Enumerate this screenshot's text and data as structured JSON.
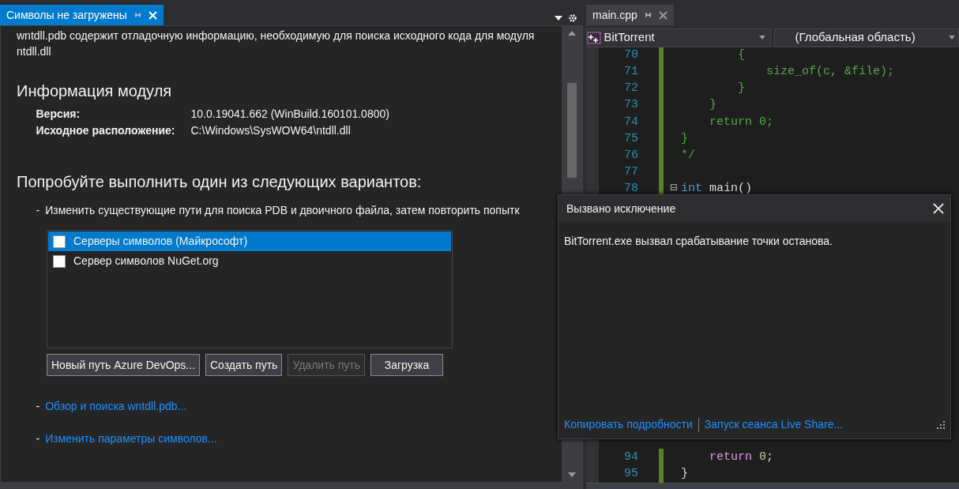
{
  "left_pane": {
    "tab": {
      "title": "Символы не загружены",
      "selected": true
    },
    "description": "wntdll.pdb содержит отладочную информацию, необходимую для поиска исходного кода для модуля ntdll.dll",
    "module_info": {
      "heading": "Информация модуля",
      "fields": [
        {
          "label": "Версия:",
          "value": "10.0.19041.662 (WinBuild.160101.0800)"
        },
        {
          "label": "Исходное расположение:",
          "value": "C:\\Windows\\SysWOW64\\ntdll.dll"
        }
      ]
    },
    "options_heading": "Попробуйте выполнить один из следующих вариантов:",
    "option_dash": "-",
    "option_text": "Изменить существующие пути для поиска PDB и двоичного файла, затем повторить попытк",
    "symbol_servers": [
      {
        "label": "Серверы символов (Майкрософт)",
        "checked": false,
        "selected": true
      },
      {
        "label": "Сервер символов NuGet.org",
        "checked": false,
        "selected": false
      }
    ],
    "buttons": [
      {
        "label": "Новый путь Azure DevOps...",
        "disabled": false
      },
      {
        "label": "Создать путь",
        "disabled": false
      },
      {
        "label": "Удалить путь",
        "disabled": true
      },
      {
        "label": "Загрузка",
        "disabled": false
      }
    ],
    "links": [
      {
        "dash": "-",
        "text": "Обзор и поиска wntdll.pdb..."
      },
      {
        "dash": "-",
        "text": "Изменить параметры символов..."
      }
    ]
  },
  "editor": {
    "tab": {
      "title": "main.cpp",
      "selected": false
    },
    "project_dropdown": "BitTorrent",
    "scope_dropdown": "(Глобальная область)",
    "lines": [
      {
        "number": "70",
        "tokens": [
          {
            "text": "        {",
            "kind": "comment"
          }
        ]
      },
      {
        "number": "71",
        "tokens": [
          {
            "text": "            size_of(c, &file);",
            "kind": "comment"
          }
        ]
      },
      {
        "number": "72",
        "tokens": [
          {
            "text": "        }",
            "kind": "comment"
          }
        ]
      },
      {
        "number": "73",
        "tokens": [
          {
            "text": "    }",
            "kind": "comment"
          }
        ]
      },
      {
        "number": "74",
        "tokens": [
          {
            "text": "    return 0;",
            "kind": "comment"
          }
        ]
      },
      {
        "number": "75",
        "tokens": [
          {
            "text": "}",
            "kind": "comment"
          }
        ]
      },
      {
        "number": "76",
        "tokens": [
          {
            "text": "*/",
            "kind": "comment"
          }
        ]
      },
      {
        "number": "77"
      },
      {
        "number": "78",
        "fold": "⊟",
        "tokens": [
          {
            "text": "int",
            "kind": "keyword"
          },
          {
            "text": " main()",
            "kind": "plain"
          }
        ]
      },
      {
        "number": "94",
        "tokens": [
          {
            "text": "    return",
            "kind": "control"
          },
          {
            "text": " 0",
            "kind": "number"
          },
          {
            "text": ";",
            "kind": "plain"
          }
        ]
      },
      {
        "number": "95",
        "tokens": [
          {
            "text": "}",
            "kind": "plain"
          }
        ]
      }
    ]
  },
  "exception_popup": {
    "title": "Вызвано исключение",
    "message": "BitTorrent.exe вызвал срабатывание точки останова.",
    "links": [
      "Копировать подробности",
      "Запуск сеанса Live Share..."
    ]
  }
}
